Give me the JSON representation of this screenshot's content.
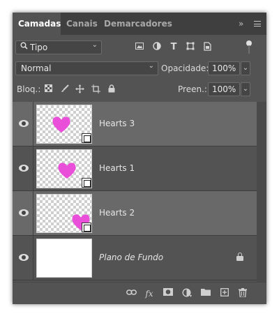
{
  "tabs": [
    {
      "label": "Camadas",
      "active": true
    },
    {
      "label": "Canais",
      "active": false
    },
    {
      "label": "Demarcadores",
      "active": false
    }
  ],
  "header_icons": {
    "collapse": "collapse-chevrons-icon",
    "menu": "panel-menu-icon"
  },
  "filter": {
    "type_label": "Tipo",
    "icons": [
      "pixel-filter-icon",
      "adjustment-filter-icon",
      "type-filter-icon",
      "shape-filter-icon",
      "smart-object-filter-icon"
    ],
    "type_glyph": "T"
  },
  "blend": {
    "mode": "Normal",
    "opacity_label": "Opacidade:",
    "opacity_value": "100%",
    "fill_label": "Preen.:",
    "fill_value": "100%"
  },
  "lock": {
    "label": "Bloq.:",
    "icons": [
      "lock-transparent-icon",
      "lock-image-icon",
      "lock-position-icon",
      "lock-artboard-icon",
      "lock-all-icon"
    ]
  },
  "layers": [
    {
      "name": "Hearts 3",
      "selected": true,
      "thumb": "heart",
      "smart_object": true,
      "locked": false,
      "italic": false
    },
    {
      "name": "Hearts 1",
      "selected": false,
      "thumb": "heart",
      "smart_object": true,
      "locked": false,
      "italic": false
    },
    {
      "name": "Hearts 2",
      "selected": true,
      "thumb": "heart",
      "smart_object": true,
      "locked": false,
      "italic": false
    },
    {
      "name": "Plano de Fundo",
      "selected": false,
      "thumb": "white",
      "smart_object": false,
      "locked": true,
      "italic": true
    }
  ],
  "colors": {
    "heart": "#e94fd9",
    "selected_row": "#696969",
    "panel": "#535353"
  },
  "bottom_icons": [
    "link-layers-icon",
    "fx-icon",
    "add-mask-icon",
    "adjustment-layer-icon",
    "new-group-icon",
    "new-layer-icon",
    "delete-icon"
  ],
  "bottom_fx": "fx"
}
